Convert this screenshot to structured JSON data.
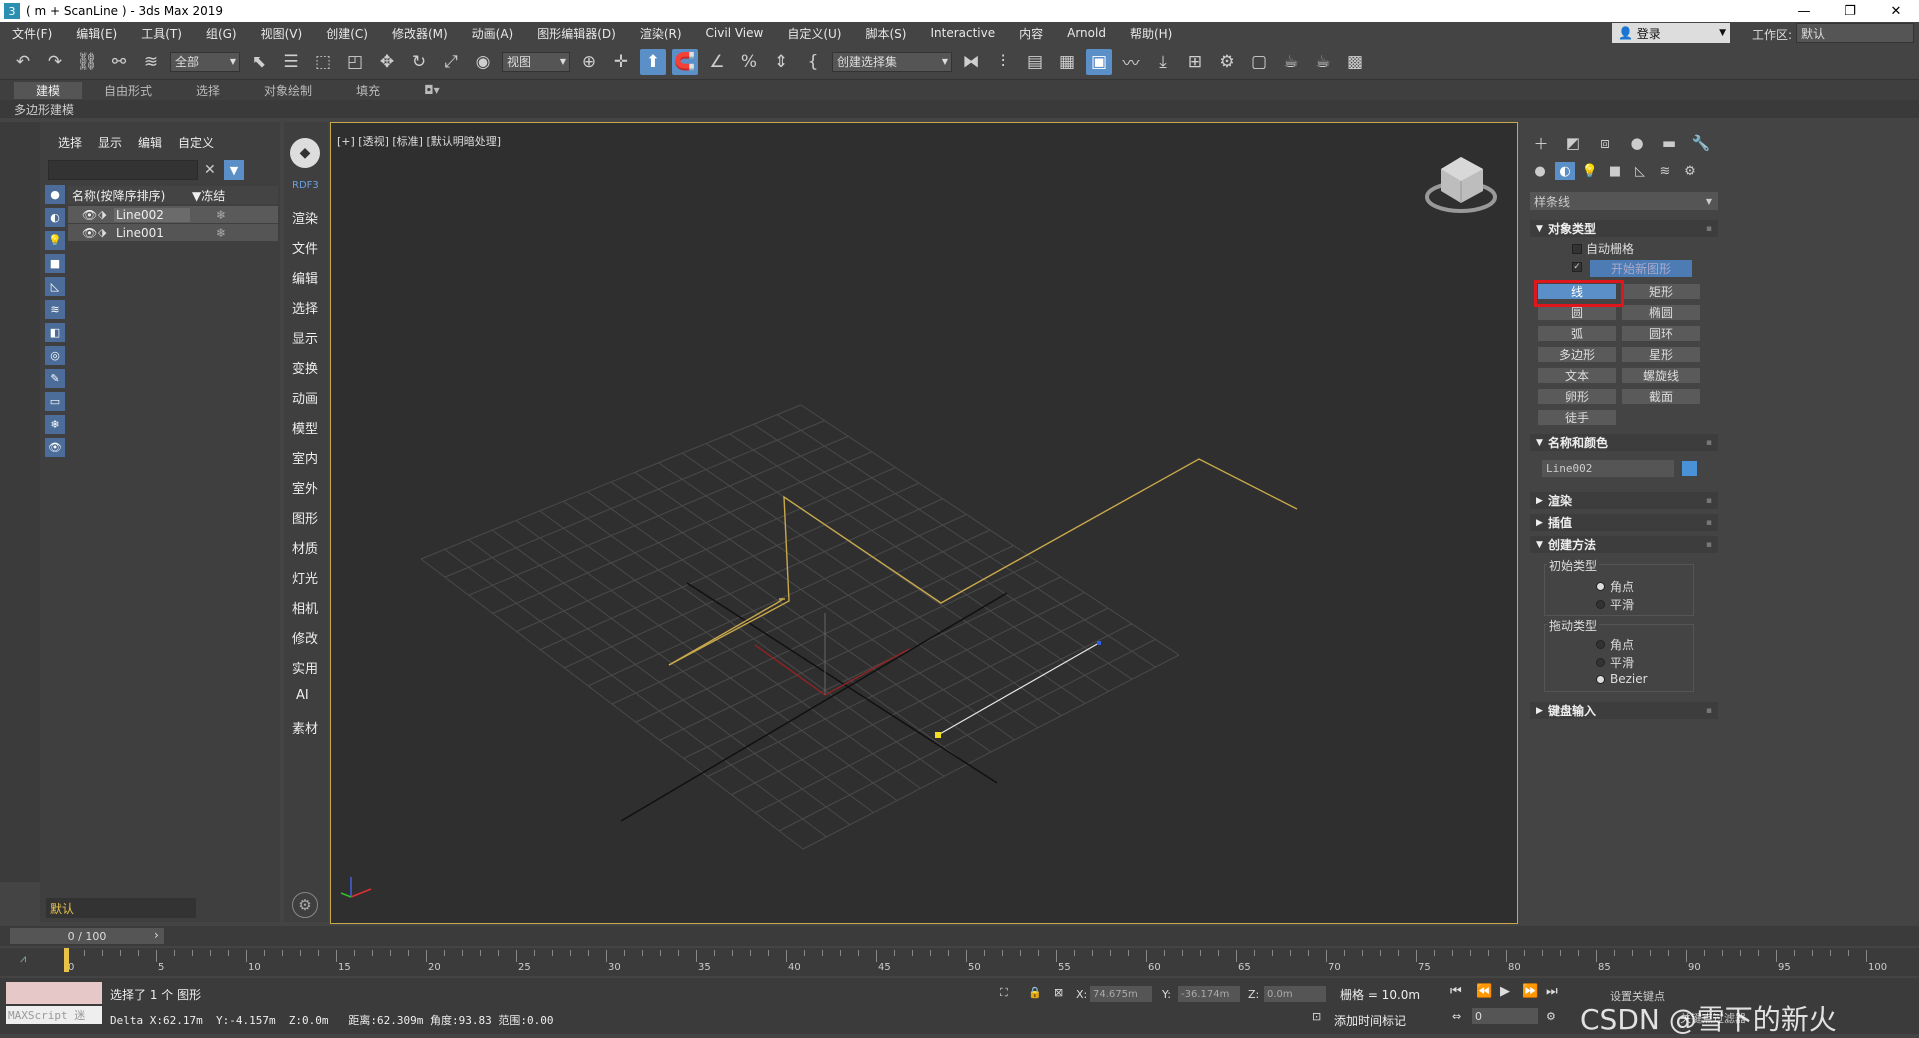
{
  "window": {
    "title": "( m + ScanLine ) - 3ds Max 2019",
    "icon": "3",
    "min": "—",
    "max": "❐",
    "close": "✕"
  },
  "menu": [
    "文件(F)",
    "编辑(E)",
    "工具(T)",
    "组(G)",
    "视图(V)",
    "创建(C)",
    "修改器(M)",
    "动画(A)",
    "图形编辑器(D)",
    "渲染(R)",
    "Civil View",
    "自定义(U)",
    "脚本(S)",
    "Interactive",
    "内容",
    "Arnold",
    "帮助(H)"
  ],
  "account": {
    "login": "登录",
    "workspace_label": "工作区:",
    "workspace_value": "默认"
  },
  "toolbar": {
    "selection_filter": "全部",
    "ref_coord": "视图",
    "named_sel": "创建选择集"
  },
  "ribbon": {
    "tabs": [
      "建模",
      "自由形式",
      "选择",
      "对象绘制",
      "填充"
    ],
    "sub": "多边形建模"
  },
  "scene_explorer": {
    "tabs": [
      "选择",
      "显示",
      "编辑",
      "自定义"
    ],
    "col_name": "名称(按降序排序)",
    "col_frozen": "▼冻结",
    "rows": [
      {
        "name": "Line002",
        "frozen": "❄"
      },
      {
        "name": "Line001",
        "frozen": "❄"
      }
    ],
    "layer": "默认"
  },
  "rdf": {
    "label": "RDF3",
    "items": [
      "渲染",
      "文件",
      "编辑",
      "选择",
      "显示",
      "变换",
      "动画",
      "模型",
      "室内",
      "室外",
      "图形",
      "材质",
      "灯光",
      "相机",
      "修改",
      "实用",
      "AI",
      "素材"
    ]
  },
  "viewport": {
    "label": "[+] [透视] [标准] [默认明暗处理]"
  },
  "command_panel": {
    "category": "样条线",
    "object_type": "对象类型",
    "auto_grid": "自动栅格",
    "start_new_shape": "开始新图形",
    "buttons": [
      "线",
      "矩形",
      "圆",
      "椭圆",
      "弧",
      "圆环",
      "多边形",
      "星形",
      "文本",
      "螺旋线",
      "卵形",
      "截面",
      "徒手"
    ],
    "name_color": "名称和颜色",
    "object_name": "Line002",
    "object_color": "#4a92d8",
    "rollouts": [
      "渲染",
      "插值",
      "创建方法"
    ],
    "init_type": "初始类型",
    "init_opts": [
      "角点",
      "平滑"
    ],
    "drag_type": "拖动类型",
    "drag_opts": [
      "角点",
      "平滑",
      "Bezier"
    ],
    "keyboard": "键盘输入"
  },
  "timeline": {
    "frame": "0 / 100",
    "ticks": [
      "0",
      "5",
      "10",
      "15",
      "20",
      "25",
      "30",
      "35",
      "40",
      "45",
      "50",
      "55",
      "60",
      "65",
      "70",
      "75",
      "80",
      "85",
      "90",
      "95",
      "100"
    ]
  },
  "status": {
    "maxscript": "MAXScript 迷",
    "selected": "选择了 1 个 图形",
    "delta": "Delta X:62.17m  Y:-4.157m  Z:0.0m   距离:62.309m 角度:93.83 范围:0.00",
    "x": "74.675m",
    "y": "-36.174m",
    "z": "0.0m",
    "grid": "栅格 = 10.0m",
    "add_time_tag": "添加时间标记",
    "frame": "0",
    "set_key": "设置关键点",
    "key_filter": "关键点过滤器",
    "watermark": "CSDN @雪下的新火"
  }
}
